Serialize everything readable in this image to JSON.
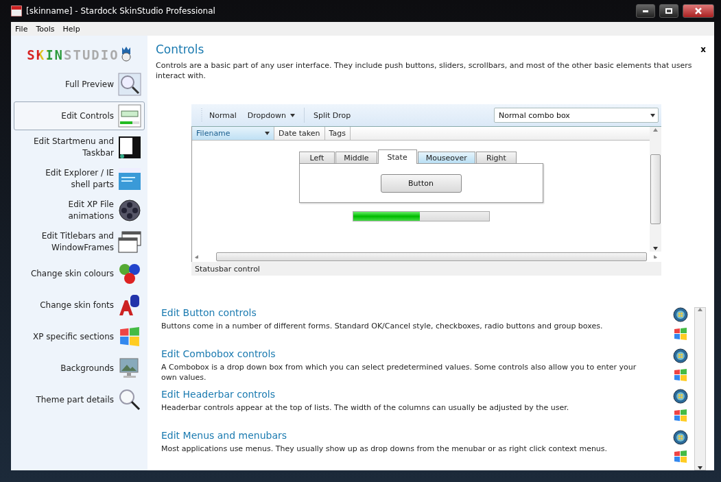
{
  "window": {
    "title": "[skinname] - Stardock SkinStudio Professional"
  },
  "menu": [
    "File",
    "Tools",
    "Help"
  ],
  "sidebar": {
    "logo": "SKINSTUDIO",
    "items": [
      {
        "label": "Full Preview",
        "kind": "preview",
        "selected": false
      },
      {
        "label": "Edit Controls",
        "kind": "controls",
        "selected": true
      },
      {
        "label": "Edit Startmenu and Taskbar",
        "kind": "startmenu",
        "selected": false
      },
      {
        "label": "Edit Explorer / IE shell parts",
        "kind": "explorer",
        "selected": false
      },
      {
        "label": "Edit XP File animations",
        "kind": "film",
        "selected": false
      },
      {
        "label": "Edit Titlebars and WindowFrames",
        "kind": "frames",
        "selected": false
      },
      {
        "label": "Change skin colours",
        "kind": "colours",
        "selected": false
      },
      {
        "label": "Change skin fonts",
        "kind": "fonts",
        "selected": false
      },
      {
        "label": "XP specific sections",
        "kind": "xp",
        "selected": false
      },
      {
        "label": "Backgrounds",
        "kind": "backgrounds",
        "selected": false
      },
      {
        "label": "Theme part details",
        "kind": "magnifier",
        "selected": false
      }
    ]
  },
  "main": {
    "title": "Controls",
    "close": "x",
    "description": "Controls are a basic part of any user interface.  They include push buttons, sliders, scrollbars, and most of the other basic elements that users interact with.",
    "demo": {
      "toolbar": [
        {
          "label": "Normal",
          "kind": "plain"
        },
        {
          "label": "Dropdown",
          "kind": "dropdown"
        },
        {
          "label": "Split Drop",
          "kind": "plain"
        }
      ],
      "combo": "Normal combo box",
      "columns": [
        {
          "label": "Filename",
          "selected": true
        },
        {
          "label": "Date taken",
          "selected": false
        },
        {
          "label": "Tags",
          "selected": false
        }
      ],
      "tabs": [
        {
          "label": "Left",
          "selected": false,
          "hover": false
        },
        {
          "label": "Middle",
          "selected": false,
          "hover": false
        },
        {
          "label": "State",
          "selected": true,
          "hover": false
        },
        {
          "label": "Mouseover",
          "selected": false,
          "hover": true
        },
        {
          "label": "Right",
          "selected": false,
          "hover": false
        }
      ],
      "button": "Button",
      "progress": {
        "level": 0.49
      },
      "statusbar": "Statusbar control"
    },
    "sections": [
      {
        "title": "Edit Button controls",
        "description": "Buttons come in a number of different forms.  Standard OK/Cancel style, checkboxes, radio buttons and group boxes."
      },
      {
        "title": "Edit Combobox controls",
        "description": "A Combobox is a drop down box from which you can select predetermined values.  Some controls also allow you to enter your own values."
      },
      {
        "title": "Edit Headerbar controls",
        "description": "Headerbar controls appear at the top of lists.  The width of the columns can usually be adjusted by the user."
      },
      {
        "title": "Edit Menus and menubars",
        "description": "Most applications use menus.  They usually show up as drop downs from the menubar or as right click context menus."
      }
    ]
  }
}
